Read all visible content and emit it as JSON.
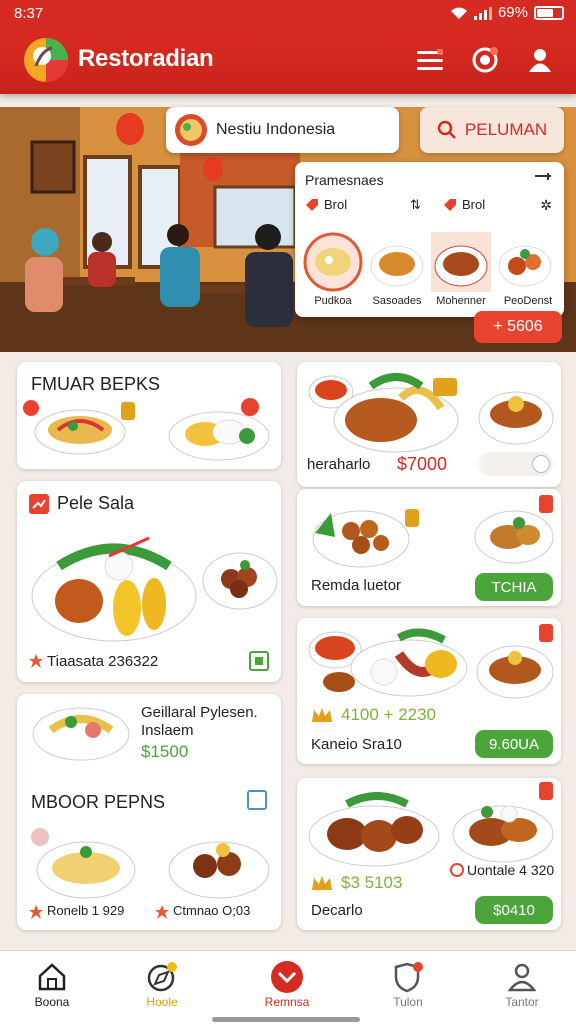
{
  "status": {
    "time": "8:37",
    "battery": "69%"
  },
  "app": {
    "title": "Restoradian"
  },
  "hero": {
    "location": "Nestiu Indonesia",
    "search_label": "PELUMAN"
  },
  "popup": {
    "title": "Pramesnaes",
    "left_label": "Brol",
    "right_label": "Brol",
    "items": [
      "Pudkoa",
      "Sasoades",
      "Mohenner",
      "PeoDenst"
    ],
    "price_tag": "+ 5606"
  },
  "cards": {
    "c1": {
      "title": "FMUAR BEPKS"
    },
    "c2": {
      "title": "Pele Sala",
      "rating": "Tiaasata 236322"
    },
    "c3": {
      "name": "Geillaral Pylesen. Inslaem",
      "price": "$1500"
    },
    "c4": {
      "title": "MBOOR PEPNS",
      "item1": "Ronelb 1 929",
      "item2": "Ctmnao O;03"
    },
    "r1": {
      "label": "heraharlo",
      "price": "$7000"
    },
    "r2": {
      "label": "Remda luetor",
      "button": "TCHIA"
    },
    "r3": {
      "price": "4100 + 2230",
      "label": "Kaneio Sra10",
      "button": "9.60UA"
    },
    "r4": {
      "price": "$3 5103",
      "label": "Decarlo",
      "side": "Uontale 4 320",
      "button": "$0410"
    }
  },
  "nav": [
    {
      "label": "Boona",
      "icon": "home-icon",
      "color": "#222"
    },
    {
      "label": "Hoole",
      "icon": "compass-icon",
      "color": "#d9a400"
    },
    {
      "label": "Remnsa",
      "icon": "chevron-circle-icon",
      "color": "#d62b22"
    },
    {
      "label": "Tulon",
      "icon": "shield-icon",
      "color": "#777"
    },
    {
      "label": "Tantor",
      "icon": "profile-icon",
      "color": "#777"
    }
  ],
  "colors": {
    "brand_red": "#d62b22",
    "green": "#4ca53b",
    "background": "#f3ece6"
  }
}
